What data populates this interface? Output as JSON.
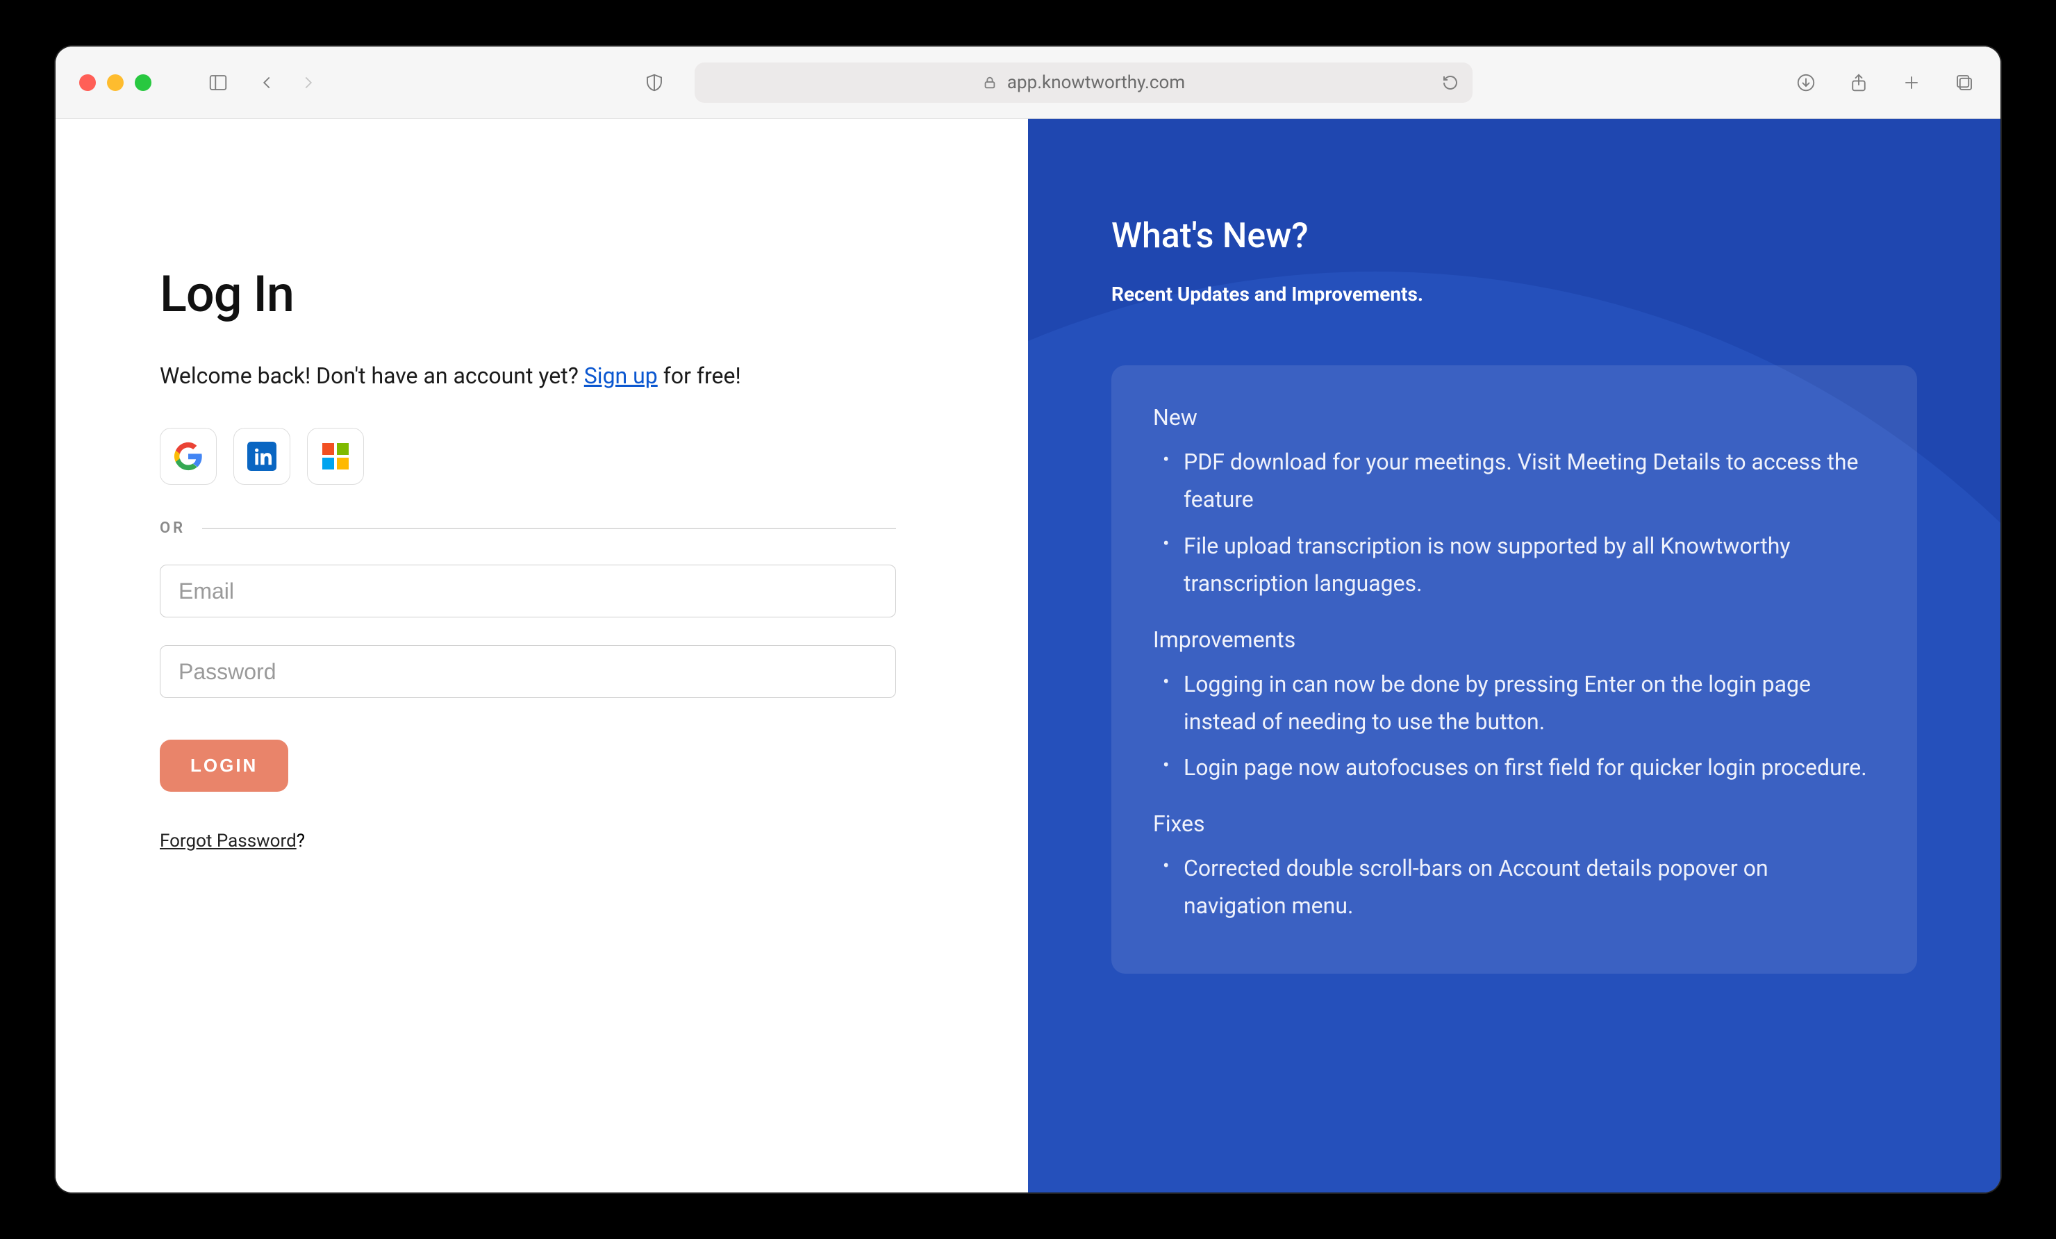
{
  "browser": {
    "url": "app.knowtworthy.com"
  },
  "login": {
    "title": "Log In",
    "welcome_pre": "Welcome back! Don't have an account yet? ",
    "signup_link": "Sign up",
    "welcome_post": " for free!",
    "or_label": "OR",
    "email_placeholder": "Email",
    "password_placeholder": "Password",
    "login_button": "LOGIN",
    "forgot_link": "Forgot Password",
    "forgot_q": "?"
  },
  "whatsnew": {
    "title": "What's New?",
    "subtitle": "Recent Updates and Improvements.",
    "sections": [
      {
        "heading": "New",
        "items": [
          "PDF download for your meetings. Visit Meeting Details to access the feature",
          "File upload transcription is now supported by all Knowtworthy transcription languages."
        ]
      },
      {
        "heading": "Improvements",
        "items": [
          "Logging in can now be done by pressing Enter on the login page instead of needing to use the button.",
          "Login page now autofocuses on first field for quicker login procedure."
        ]
      },
      {
        "heading": "Fixes",
        "items": [
          "Corrected double scroll-bars on Account details popover on navigation menu."
        ]
      }
    ]
  }
}
